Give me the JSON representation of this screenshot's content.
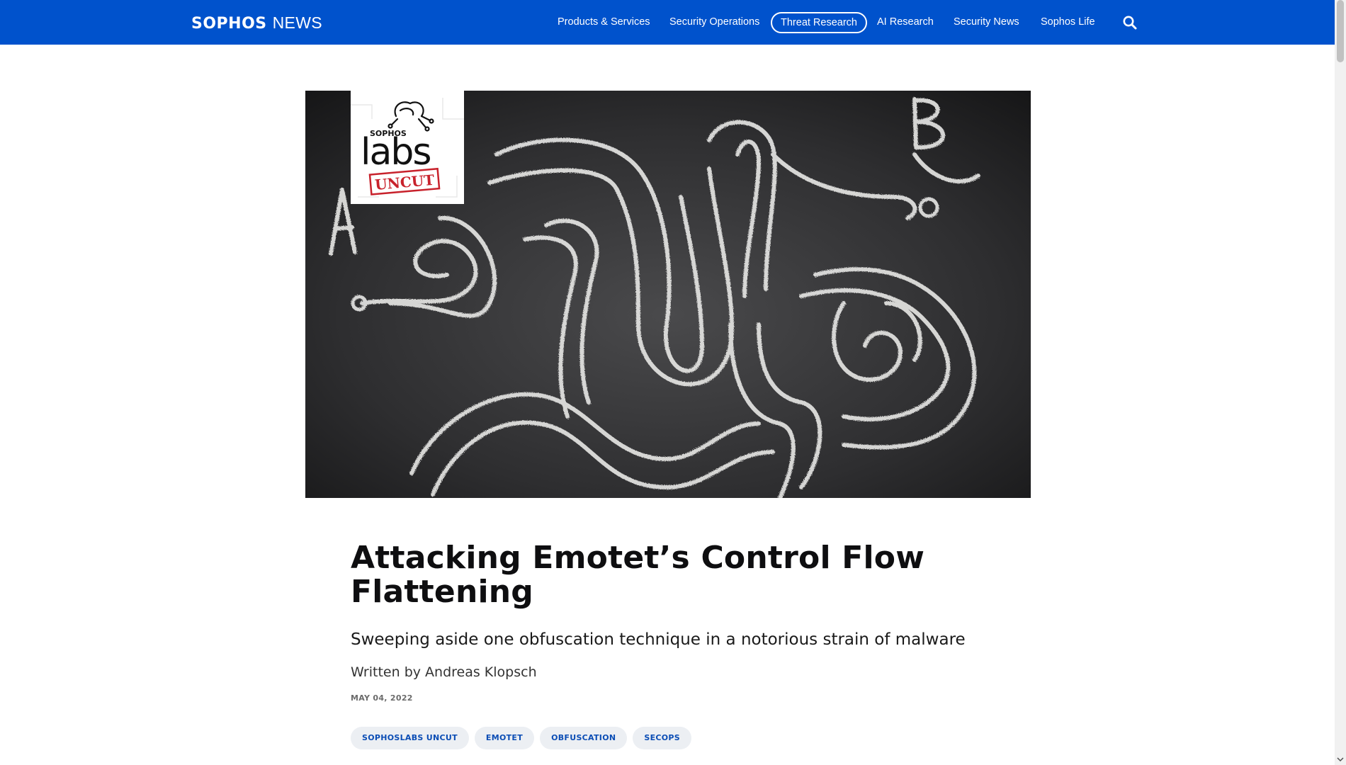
{
  "header": {
    "logo_brand": "SOPHOS",
    "logo_suffix": "NEWS",
    "nav": [
      {
        "label": "Products & Services",
        "active": false
      },
      {
        "label": "Security Operations",
        "active": false
      },
      {
        "label": "Threat Research",
        "active": true
      },
      {
        "label": "AI Research",
        "active": false
      },
      {
        "label": "Security News",
        "active": false
      },
      {
        "label": "Sophos Life",
        "active": false
      }
    ],
    "search_icon": "search-icon",
    "colors": {
      "bar": "#0052cc",
      "text": "#ffffff"
    }
  },
  "hero": {
    "badge": {
      "brand": "SOPHOS",
      "word": "labs",
      "stamp": "UNCUT"
    },
    "chalk_letters": [
      "A",
      "B"
    ]
  },
  "article": {
    "title": "Attacking Emotet’s Control Flow Flattening",
    "subtitle": "Sweeping aside one obfuscation technique in a notorious strain of malware",
    "byline_prefix": "Written by",
    "author": "Andreas Klopsch",
    "date": "MAY 04, 2022",
    "tags": [
      "SOPHOSLABS UNCUT",
      "EMOTET",
      "OBFUSCATION",
      "SECOPS"
    ]
  }
}
